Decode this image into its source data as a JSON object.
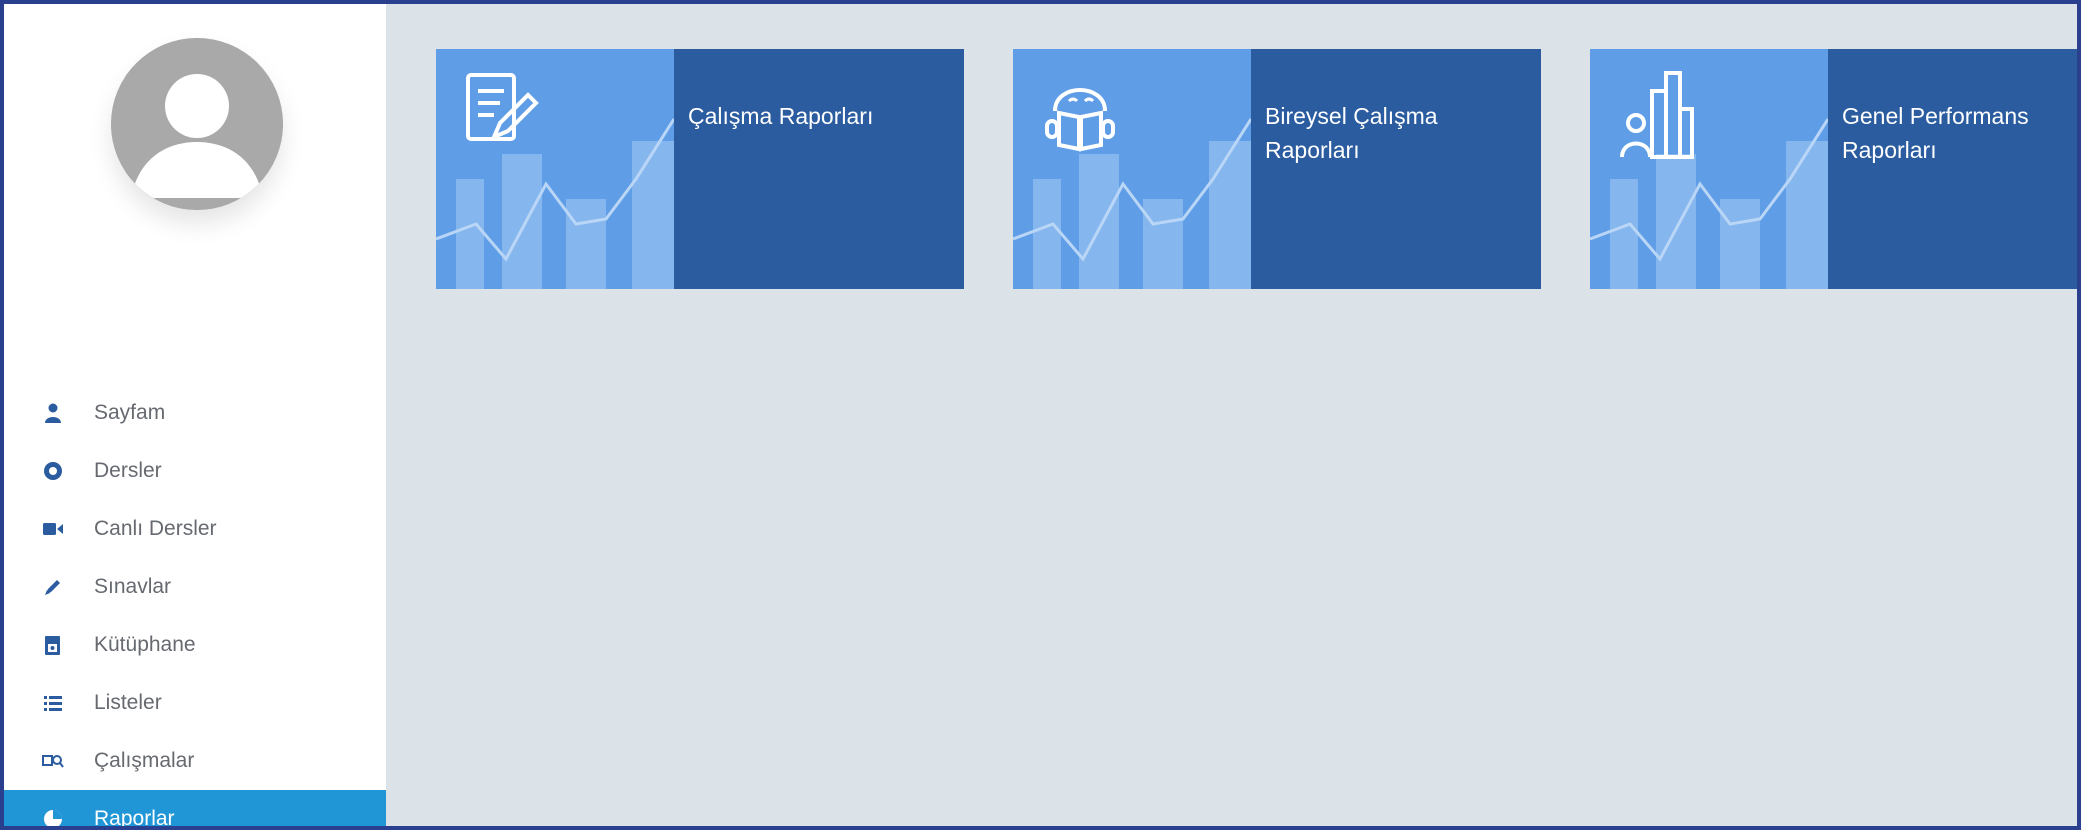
{
  "sidebar": {
    "avatar_icon": "user-avatar-icon",
    "items": [
      {
        "label": "Sayfam",
        "icon": "user-icon",
        "active": false
      },
      {
        "label": "Dersler",
        "icon": "play-circle-icon",
        "active": false
      },
      {
        "label": "Canlı Dersler",
        "icon": "video-camera-icon",
        "active": false
      },
      {
        "label": "Sınavlar",
        "icon": "pencil-icon",
        "active": false
      },
      {
        "label": "Kütüphane",
        "icon": "library-book-icon",
        "active": false
      },
      {
        "label": "Listeler",
        "icon": "list-icon",
        "active": false
      },
      {
        "label": "Çalışmalar",
        "icon": "study-icon",
        "active": false
      },
      {
        "label": "Raporlar",
        "icon": "pie-chart-icon",
        "active": true
      }
    ]
  },
  "cards": [
    {
      "title": "Çalışma Raporları",
      "icon": "edit-document-icon"
    },
    {
      "title": "Bireysel Çalışma Raporları",
      "icon": "reading-person-icon"
    },
    {
      "title": "Genel Performans Raporları",
      "icon": "person-bar-chart-icon"
    }
  ],
  "colors": {
    "sidebar_active": "#2196d7",
    "card_label_bg": "#2a5c9f",
    "card_art_bg": "#5f9de7",
    "main_bg": "#dce3e8",
    "frame_border": "#2b3f8f"
  }
}
